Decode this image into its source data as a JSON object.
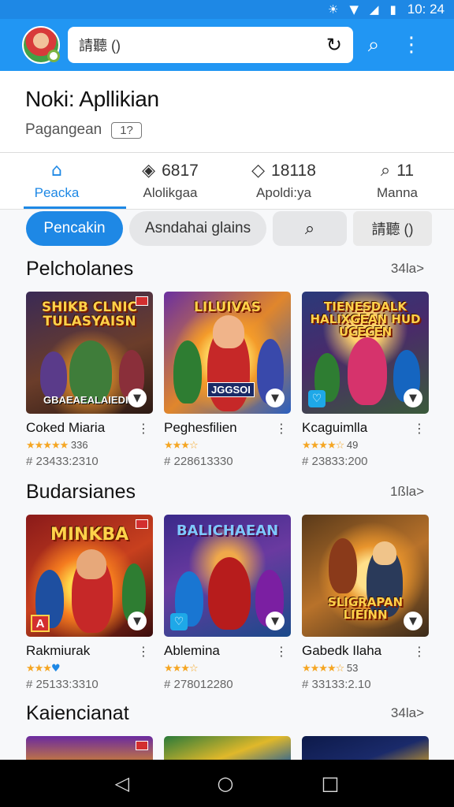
{
  "status_bar": {
    "time": "10: 24",
    "icons": [
      "brightness-icon",
      "wifi-icon",
      "signal-icon",
      "battery-icon"
    ]
  },
  "app_bar": {
    "search_text": "請聽 ()",
    "icons": [
      "refresh-icon",
      "search-icon",
      "more-vert-icon"
    ]
  },
  "header": {
    "title": "Noki: Apllikian",
    "subtitle": "Pagangean",
    "badge": "1?"
  },
  "tabs": [
    {
      "icon": "home-icon",
      "glyph": "⌂",
      "count": "",
      "label": "Peacka",
      "active": true
    },
    {
      "icon": "tag-icon",
      "glyph": "◈",
      "count": "6817",
      "label": "Alolikgaa",
      "active": false
    },
    {
      "icon": "layers-icon",
      "glyph": "◇",
      "count": "18118",
      "label": "Apoldi:ya",
      "active": false
    },
    {
      "icon": "search-icon",
      "glyph": "⌕",
      "count": "11",
      "label": "Manna",
      "active": false
    }
  ],
  "chips": [
    "Pencakin",
    "Asndahai glains",
    "請聽 ()"
  ],
  "accent_color": "#1e88e5",
  "sections": [
    {
      "title": "Pelcholanes",
      "more": "34la>",
      "cards": [
        {
          "thumb_title": "SHIKB CLNIC TULASYAISN",
          "thumb_caption": "GBAEAEALAIEDIN",
          "name": "Coked Miaria",
          "stars": "★★★★★",
          "rating": "336",
          "downloads": "# 23433:2310"
        },
        {
          "thumb_title": "LILUIVAS",
          "thumb_caption": "JGGSOI",
          "name": "Peghesfilien",
          "stars": "★★★☆",
          "rating": "",
          "downloads": "# 228613330"
        },
        {
          "thumb_title": "TIENESDALK HALIXGEAN HUD UCECEN",
          "thumb_caption": "",
          "name": "Kcaguimlla",
          "stars": "★★★★☆",
          "rating": "49",
          "downloads": "# 23833:200"
        }
      ]
    },
    {
      "title": "Budarsianes",
      "more": "1ßla>",
      "cards": [
        {
          "thumb_title": "MINKBA",
          "thumb_caption": "",
          "name": "Rakmiurak",
          "stars": "★★★",
          "rating": "",
          "downloads": "# 25133:3310"
        },
        {
          "thumb_title": "BALICHAEAN",
          "thumb_caption": "",
          "name": "Ablemina",
          "stars": "★★★☆",
          "rating": "",
          "downloads": "# 278012280"
        },
        {
          "thumb_title": "SLIGRAPAN LIEINN",
          "thumb_caption": "",
          "name": "Gabedk Ilaha",
          "stars": "★★★★☆",
          "rating": "53",
          "downloads": "# 33133:2.10"
        }
      ]
    },
    {
      "title": "Kaiencianat",
      "more": "34la>"
    }
  ],
  "nav_bar": [
    "back-icon",
    "home-circle-icon",
    "recents-icon"
  ]
}
